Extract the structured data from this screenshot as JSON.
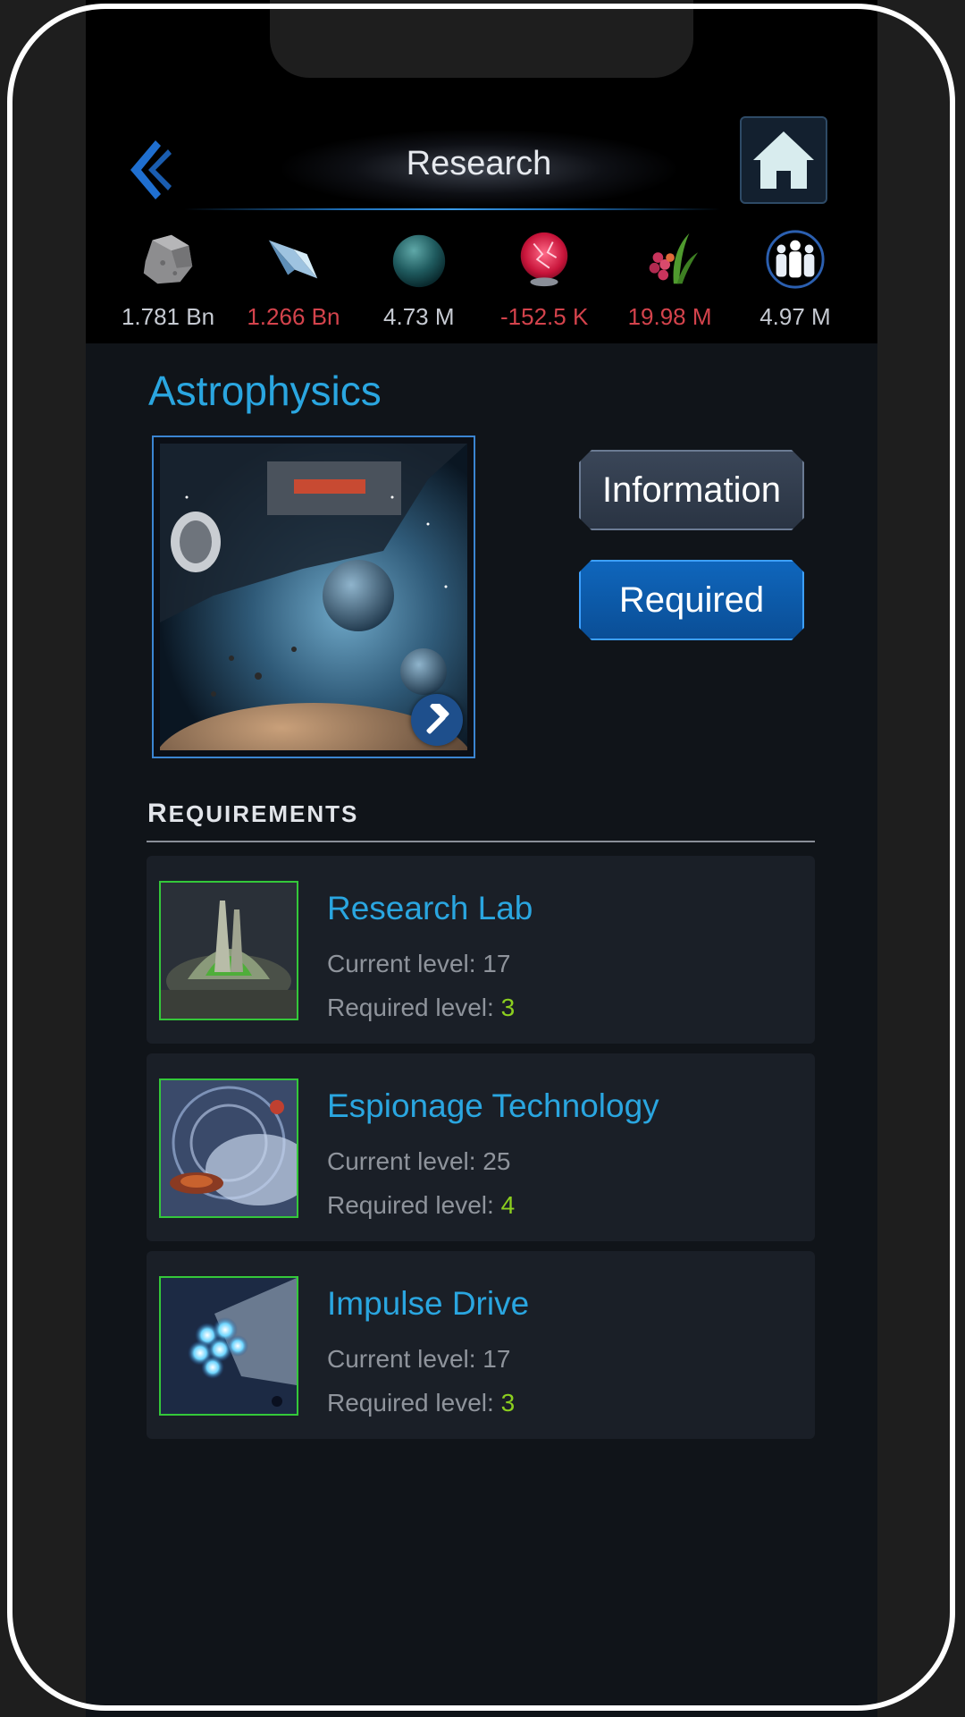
{
  "header": {
    "title": "Research"
  },
  "resources": [
    {
      "icon": "metal-ore-icon",
      "value": "1.781 Bn",
      "negative": false
    },
    {
      "icon": "crystal-icon",
      "value": "1.266 Bn",
      "negative": true
    },
    {
      "icon": "deuterium-sphere-icon",
      "value": "4.73 M",
      "negative": false
    },
    {
      "icon": "energy-plasma-icon",
      "value": "-152.5 K",
      "negative": true
    },
    {
      "icon": "food-icon",
      "value": "19.98 M",
      "negative": true
    },
    {
      "icon": "population-icon",
      "value": "4.97 M",
      "negative": false
    }
  ],
  "tech": {
    "name": "Astrophysics"
  },
  "buttons": {
    "information": "Information",
    "required": "Required"
  },
  "requirements": {
    "heading_first": "R",
    "heading_rest": "EQUIREMENTS",
    "current_prefix": "Current level: ",
    "required_prefix": "Required level: ",
    "items": [
      {
        "name": "Research Lab",
        "current": "17",
        "required": "3"
      },
      {
        "name": "Espionage Technology",
        "current": "25",
        "required": "4"
      },
      {
        "name": "Impulse Drive",
        "current": "17",
        "required": "3"
      }
    ]
  },
  "colors": {
    "accent_blue": "#2aa6e0",
    "negative_red": "#d4434c",
    "required_green": "#8ccf1f",
    "thumb_border_green": "#34c83a"
  }
}
